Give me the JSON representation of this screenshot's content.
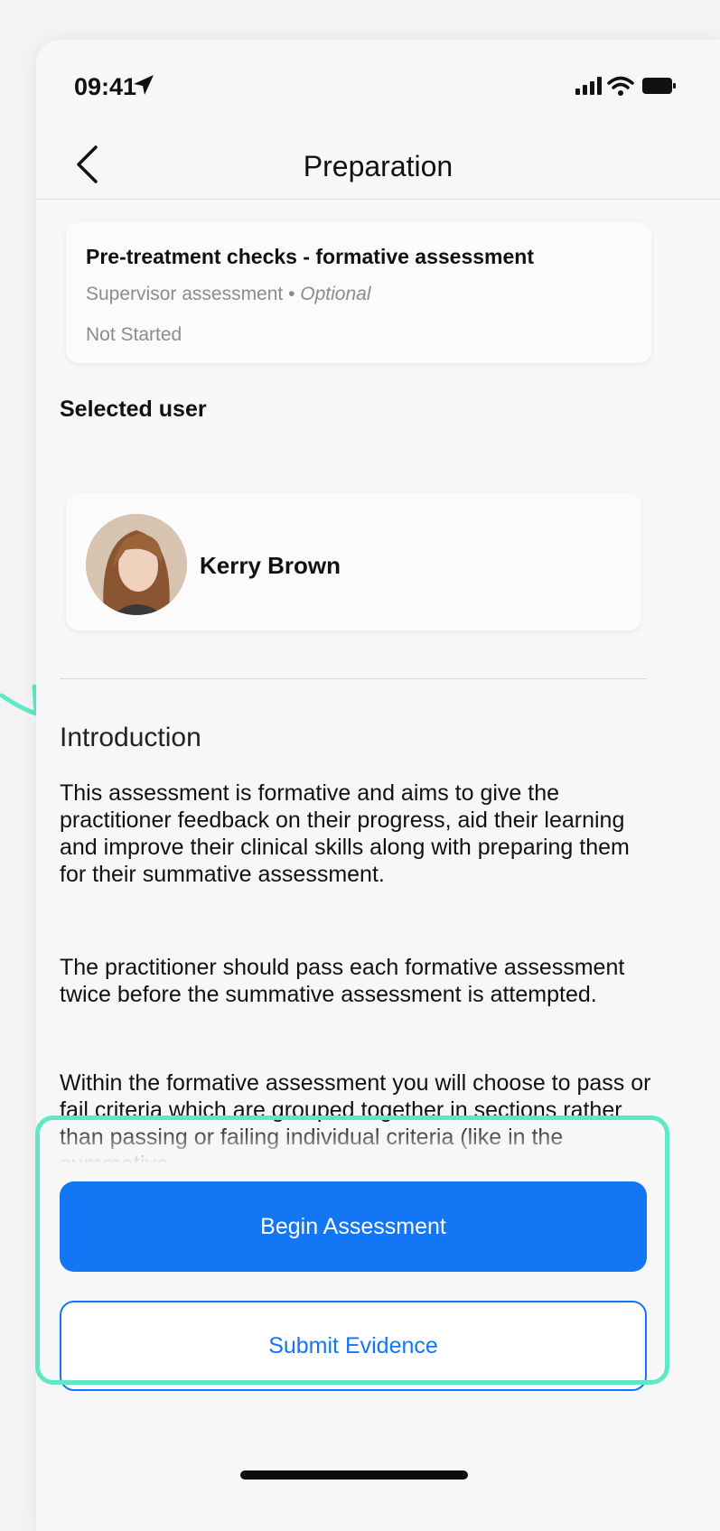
{
  "statusbar": {
    "time": "09:41"
  },
  "nav": {
    "title": "Preparation"
  },
  "assessment": {
    "title": "Pre-treatment checks - formative assessment",
    "type": "Supervisor assessment",
    "separator": " • ",
    "optional": "Optional",
    "status": "Not Started"
  },
  "selected_user": {
    "label": "Selected user",
    "name": "Kerry Brown"
  },
  "introduction": {
    "title": "Introduction",
    "paragraphs": [
      "This assessment is formative and aims to give the practitioner feedback on their progress, aid their learning and improve their clinical skills along with preparing them for their summative assessment.",
      "The practitioner should pass each formative assessment twice before the summative assessment is attempted.",
      "Within the formative assessment you will choose to pass or fail criteria which are grouped together in sections rather than passing or failing individual criteria (like in the summative"
    ]
  },
  "actions": {
    "begin": "Begin Assessment",
    "submit": "Submit Evidence"
  },
  "colors": {
    "primary": "#1376f5",
    "highlight": "#5fe8c5"
  },
  "icons": [
    "location-arrow-icon",
    "signal-icon",
    "wifi-icon",
    "battery-icon",
    "chevron-left-icon",
    "arrow-icon"
  ]
}
